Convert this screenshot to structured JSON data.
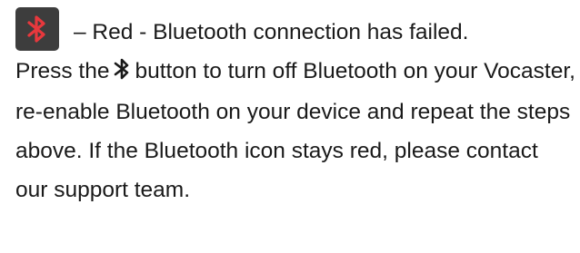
{
  "status": {
    "icon": "bluetooth-icon",
    "icon_color": "#e8383d",
    "icon_background": "#3d3d3d",
    "label": "– Red - Bluetooth connection has failed."
  },
  "instructions": {
    "before_icon": "Press the",
    "button_icon": "bluetooth-icon",
    "after_icon": "button to turn off Bluetooth on your Vocaster, re-enable Bluetooth on your device and repeat the steps above. If the Bluetooth icon stays red, please contact our support team."
  }
}
